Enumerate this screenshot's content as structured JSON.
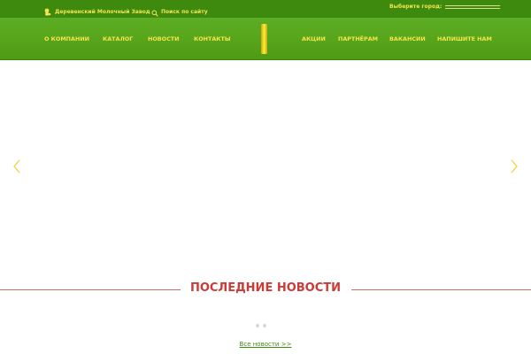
{
  "colors": {
    "topbar_bg": "#3d8a0e",
    "nav_bg": "#58a61c",
    "accent_yellow": "#f5e44a",
    "news_title": "#cc3b37",
    "link_green": "#3d8a0e"
  },
  "topbar": {
    "brand_icon": "cow-icon",
    "brand_label": "Деревенский Молочный Завод",
    "search_icon": "search-icon",
    "search_label": "Поиск по сайту",
    "city_label": "Выберите город:",
    "city_value": ""
  },
  "nav": {
    "left": [
      {
        "label": "О КОМПАНИИ"
      },
      {
        "label": "КАТАЛОГ"
      },
      {
        "label": "НОВОСТИ"
      },
      {
        "label": "КОНТАКТЫ"
      }
    ],
    "right": [
      {
        "label": "АКЦИИ"
      },
      {
        "label": "ПАРТНЁРАМ"
      },
      {
        "label": "ВАКАНСИИ"
      },
      {
        "label": "НАПИШИТЕ НАМ"
      }
    ]
  },
  "slider": {
    "prev_icon": "chevron-left-icon",
    "next_icon": "chevron-right-icon"
  },
  "news": {
    "title": "ПОСЛЕДНИЕ НОВОСТИ",
    "all_link": "Все новости >>",
    "pager_dots": 2
  }
}
